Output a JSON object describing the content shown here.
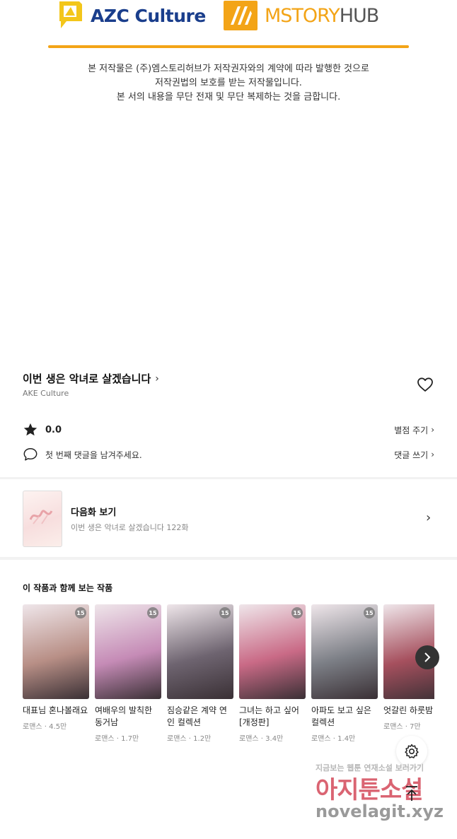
{
  "banner": {
    "logo_left_text": "AZC Culture",
    "logo_right_text_a": "MSTORY",
    "logo_right_text_b": "HUB",
    "copyright_line1": "본 저작물은 (주)엠스토리허브가 저작권자와의 계약에 따라 발행한 것으로",
    "copyright_line2": "저작권법의 보호를 받는 저작물입니다.",
    "copyright_line3": "본 서의 내용을 무단 전재 및 무단 복제하는 것을 금합니다.",
    "accent_color": "#f3a417",
    "logo_blue": "#1a3e8c"
  },
  "work": {
    "title": "이번 생은 악녀로 살겠습니다",
    "author": "AKE Culture",
    "rating": "0.0",
    "rate_link": "별점 주기",
    "comment_placeholder": "첫 번째 댓글을 남겨주세요.",
    "comment_link": "댓글 쓰기"
  },
  "next_episode": {
    "label": "다음화 보기",
    "subtitle": "이번 생은 악녀로 살겠습니다 122화"
  },
  "recommendations": {
    "title": "이 작품과 함께 보는 작품",
    "items": [
      {
        "name": "대표님 혼나볼래요",
        "genre": "로맨스",
        "views": "4.5만",
        "badge": "15",
        "cover_color": "#b88f86"
      },
      {
        "name": "여배우의 발칙한 동거남",
        "genre": "로맨스",
        "views": "1.7만",
        "badge": "15",
        "cover_color": "#c58bb6"
      },
      {
        "name": "짐승같은 계약 연인 컬렉션",
        "genre": "로맨스",
        "views": "1.2만",
        "badge": "15",
        "cover_color": "#6e6470"
      },
      {
        "name": "그녀는 하고 싶어[개정판]",
        "genre": "로맨스",
        "views": "3.4만",
        "badge": "15",
        "cover_color": "#c96a86"
      },
      {
        "name": "아파도 보고 싶은 컬렉션",
        "genre": "로맨스",
        "views": "1.4만",
        "badge": "15",
        "cover_color": "#7c7f86"
      },
      {
        "name": "엇갈린 하룻밤",
        "genre": "로맨스",
        "views": "7만",
        "badge": "",
        "cover_color": "#a6505e"
      }
    ]
  },
  "watermark": {
    "top": "지금보는 웹툰 연재소설 보러가기",
    "mid": "아지툰소설",
    "bottom": "novelagit.xyz"
  },
  "icons": [
    "heart-icon",
    "star-icon",
    "comment-icon",
    "chevron-right-icon",
    "gear-icon",
    "arrow-up-icon"
  ]
}
